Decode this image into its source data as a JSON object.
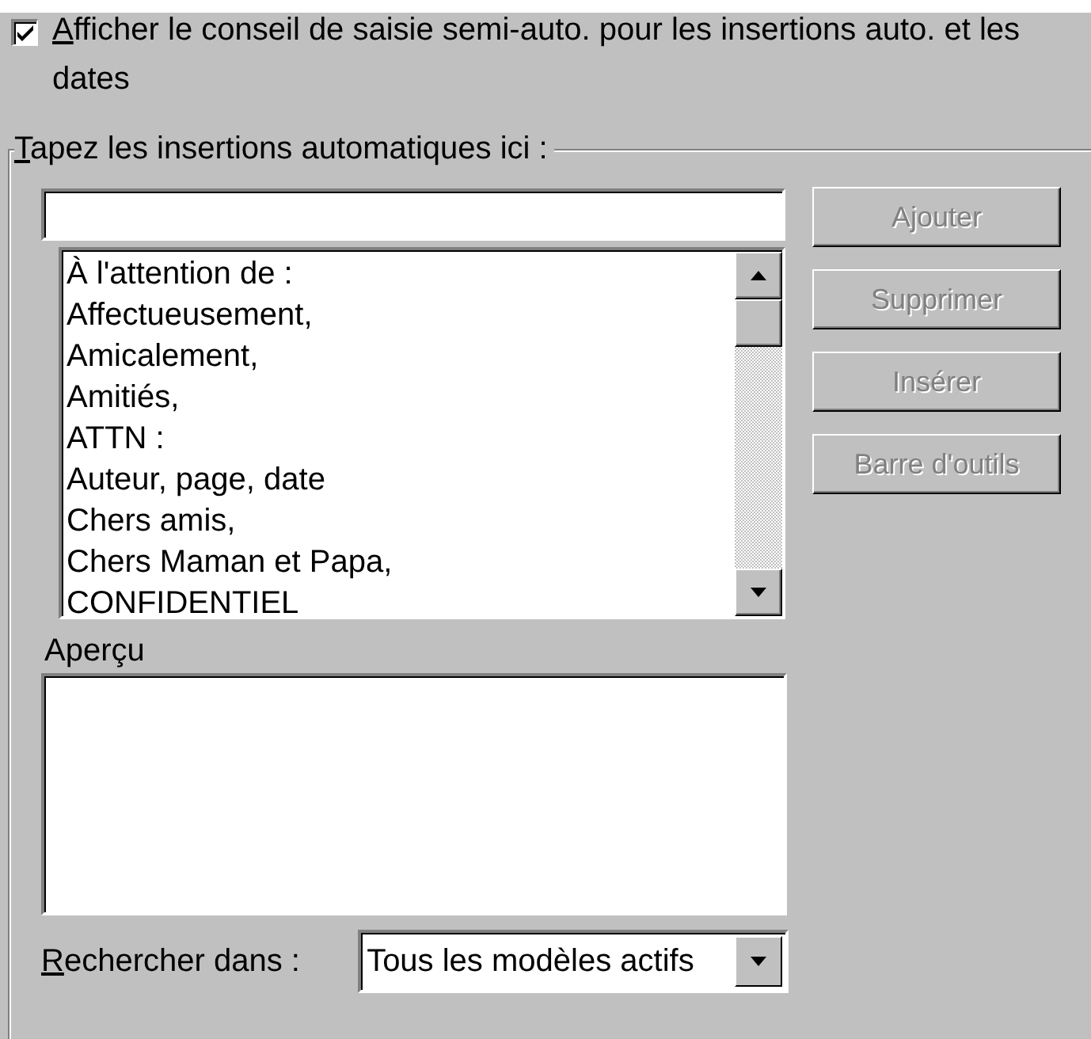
{
  "option": {
    "label": "Afficher le conseil de saisie semi-auto. pour les insertions auto. et les dates",
    "checked": true
  },
  "group": {
    "title": "Tapez les insertions automatiques ici :"
  },
  "entries": [
    {
      "label": "À l'attention de :",
      "selected": false
    },
    {
      "label": "Affectueusement,",
      "selected": false
    },
    {
      "label": "Amicalement,",
      "selected": false
    },
    {
      "label": "Amitiés,",
      "selected": false
    },
    {
      "label": "ATTN :",
      "selected": false
    },
    {
      "label": "Auteur, page, date",
      "selected": false
    },
    {
      "label": "Chers amis,",
      "selected": false
    },
    {
      "label": "Chers Maman et Papa,",
      "selected": false
    },
    {
      "label": "CONFIDENTIEL",
      "selected": false
    }
  ],
  "buttons": [
    {
      "label": "Ajouter",
      "disabled": true
    },
    {
      "label": "Supprimer",
      "disabled": true
    },
    {
      "label": "Insérer",
      "disabled": true
    },
    {
      "label": "Barre d'outils",
      "disabled": true
    }
  ],
  "preview": {
    "label": "Aperçu"
  },
  "search_in": {
    "label": "Rechercher dans :",
    "value": "Tous les modèles actifs"
  }
}
